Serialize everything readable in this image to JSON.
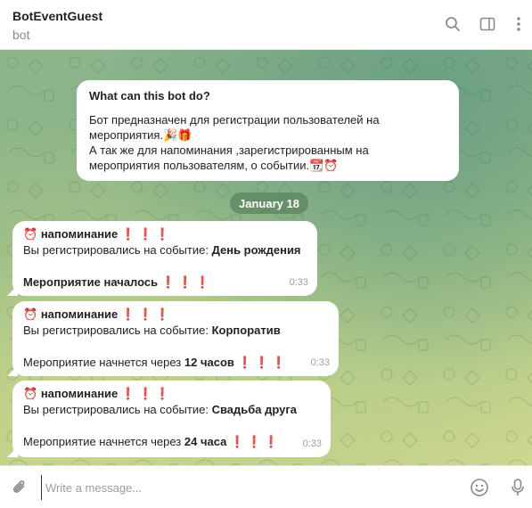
{
  "header": {
    "title": "BotEventGuest",
    "subtitle": "bot"
  },
  "intro": {
    "title": "What can this bot do?",
    "line1": "Бот предназначен для регистрации пользователей на",
    "line2": "мероприятия.🎉🎁",
    "line3": "А так же для напоминания ,зарегистрированным на",
    "line4": "мероприятия пользователям, о событии.📆⏰"
  },
  "date_label": "January 18",
  "messages": [
    {
      "heading": "напоминание",
      "line1_prefix": "Вы регистрировались на событие: ",
      "event": "День рождения",
      "status_text": "Мероприятие началось",
      "status_value": "",
      "time": "0:33"
    },
    {
      "heading": "напоминание",
      "line1_prefix": "Вы регистрировались на событие: ",
      "event": "Корпоратив",
      "status_text": "Мероприятие начнется через ",
      "status_value": "12 часов",
      "time": "0:33"
    },
    {
      "heading": "напоминание",
      "line1_prefix": "Вы регистрировались на событие: ",
      "event": "Свадьба друга",
      "status_text": "Мероприятие начнется через ",
      "status_value": "24 часа",
      "time": "0:33"
    }
  ],
  "emoji": {
    "alarm": "⏰",
    "exclaim": "❗❗❗"
  },
  "composer": {
    "placeholder": "Write a message..."
  },
  "icons": [
    "search-icon",
    "sidebar-icon",
    "more-icon",
    "attach-icon",
    "emoji-icon",
    "mic-icon"
  ]
}
